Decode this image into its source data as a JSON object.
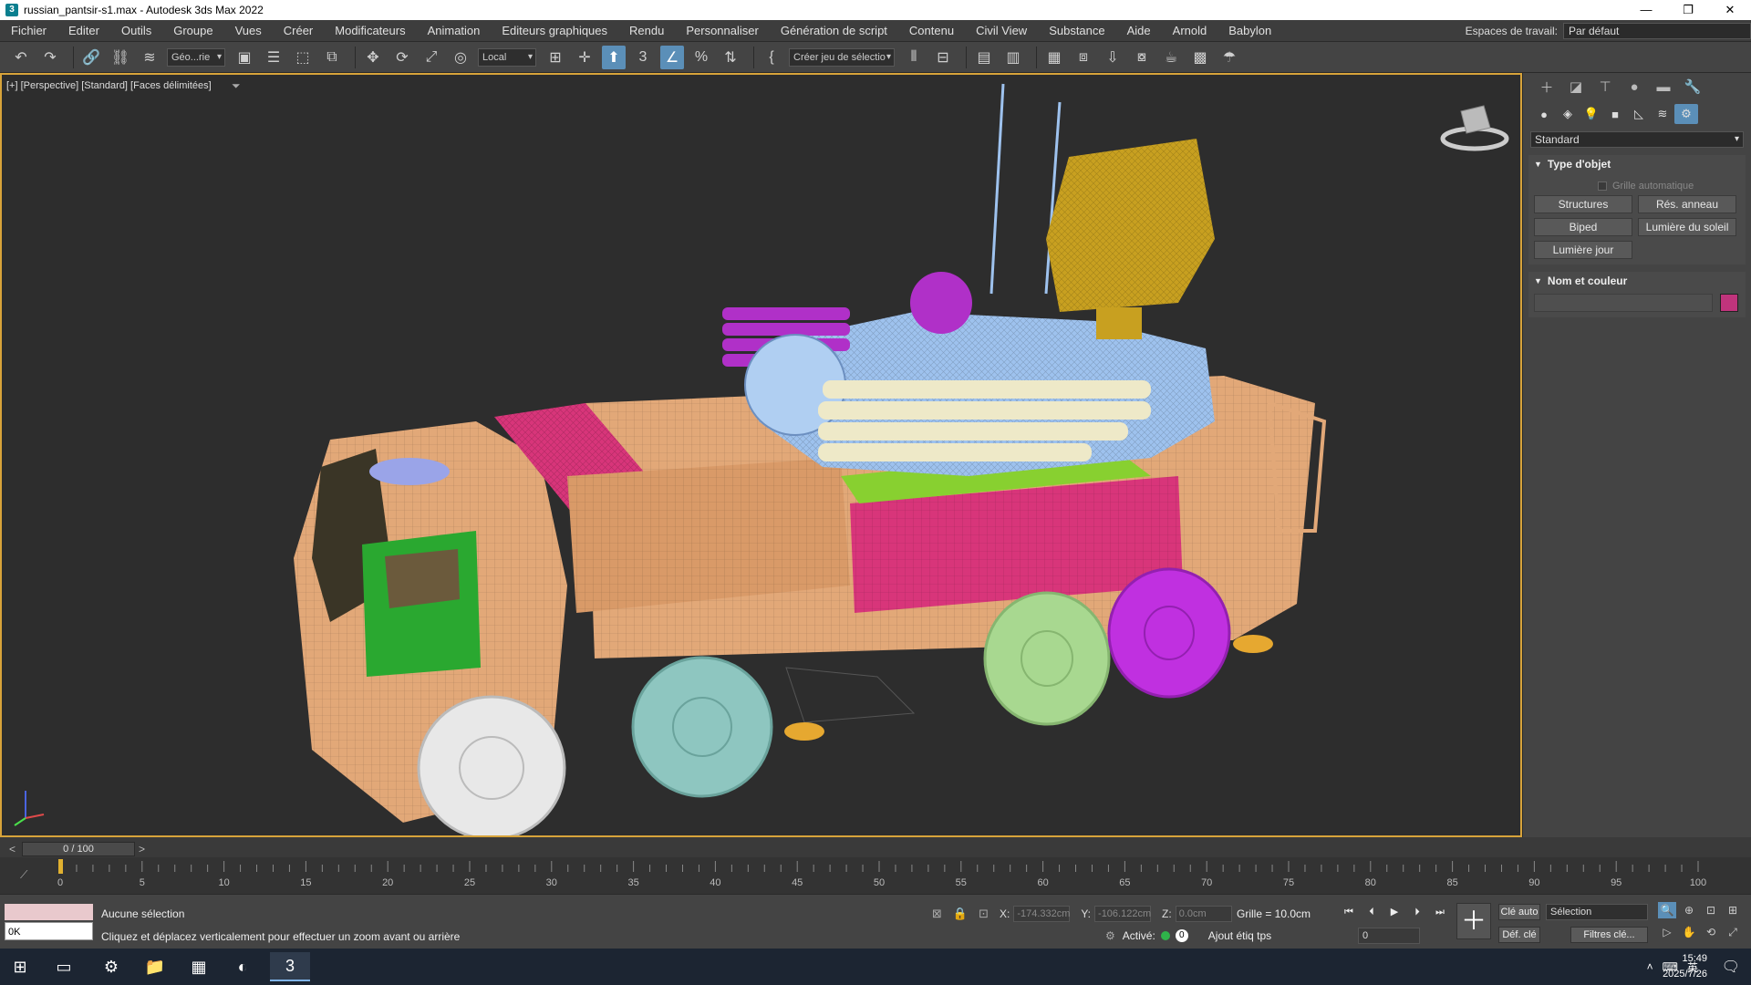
{
  "window": {
    "title": "russian_pantsir-s1.max - Autodesk 3ds Max 2022",
    "app_icon_letter": "3",
    "controls": [
      "—",
      "❐",
      "✕"
    ]
  },
  "menubar": {
    "items": [
      "Fichier",
      "Editer",
      "Outils",
      "Groupe",
      "Vues",
      "Créer",
      "Modificateurs",
      "Animation",
      "Editeurs graphiques",
      "Rendu",
      "Personnaliser",
      "Génération de script",
      "Contenu",
      "Civil View",
      "Substance",
      "Aide",
      "Arnold",
      "Babylon"
    ],
    "workspace_label": "Espaces de travail:",
    "workspace_value": "Par défaut"
  },
  "toolbar": {
    "selection_filter": "Géo...rie",
    "ref_coord": "Local",
    "named_selection": "Créer jeu de sélectio"
  },
  "viewport": {
    "label": "[+] [Perspective] [Standard] [Faces délimitées]",
    "filter_icon": "funnel-icon"
  },
  "command_panel": {
    "category": "Standard",
    "object_type": {
      "title": "Type d'objet",
      "auto_grid": "Grille automatique",
      "buttons": [
        "Structures",
        "Rés. anneau",
        "Biped",
        "Lumière du soleil",
        "Lumière jour"
      ]
    },
    "name_color": {
      "title": "Nom et couleur",
      "name_value": "",
      "color": "#c0347c"
    }
  },
  "timeline": {
    "frame_display": "0 / 100",
    "prev": "<",
    "next": ">",
    "ticks": [
      0,
      5,
      10,
      15,
      20,
      25,
      30,
      35,
      40,
      45,
      50,
      55,
      60,
      65,
      70,
      75,
      80,
      85,
      90,
      95,
      100
    ]
  },
  "status": {
    "script_output": "0K",
    "selection": "Aucune sélection",
    "prompt": "Cliquez et déplacez verticalement pour effectuer un zoom avant ou arrière",
    "x_label": "X:",
    "x_value": "-174.332cm",
    "y_label": "Y:",
    "y_value": "-106.122cm",
    "z_label": "Z:",
    "z_value": "0.0cm",
    "grid": "Grille = 10.0cm",
    "activated": "Activé:",
    "activated_count": "0",
    "add_time_tag": "Ajout étiq tps",
    "frame_value": "0",
    "auto_key": "Clé auto",
    "set_key": "Déf. clé",
    "key_selection": "Sélection",
    "key_filters": "Filtres clé..."
  },
  "taskbar": {
    "time": "15:49",
    "date": "2025/7/26",
    "lang": "英"
  },
  "colors": {
    "viewport_bg": "#2d2d2d",
    "viewport_border": "#d7a33a",
    "accent": "#5b8fb8",
    "truck_body": "#e2a878",
    "cabin_glass": "#2aa830",
    "panels": "#d8357a",
    "turret": "#9ec2ee",
    "missiles": "#b030c8",
    "radar": "#c8a020",
    "wheel_front": "#e8e8e8",
    "wheel_2": "#8ec6c0",
    "wheel_3": "#a8d890",
    "wheel_4": "#c030e0"
  }
}
